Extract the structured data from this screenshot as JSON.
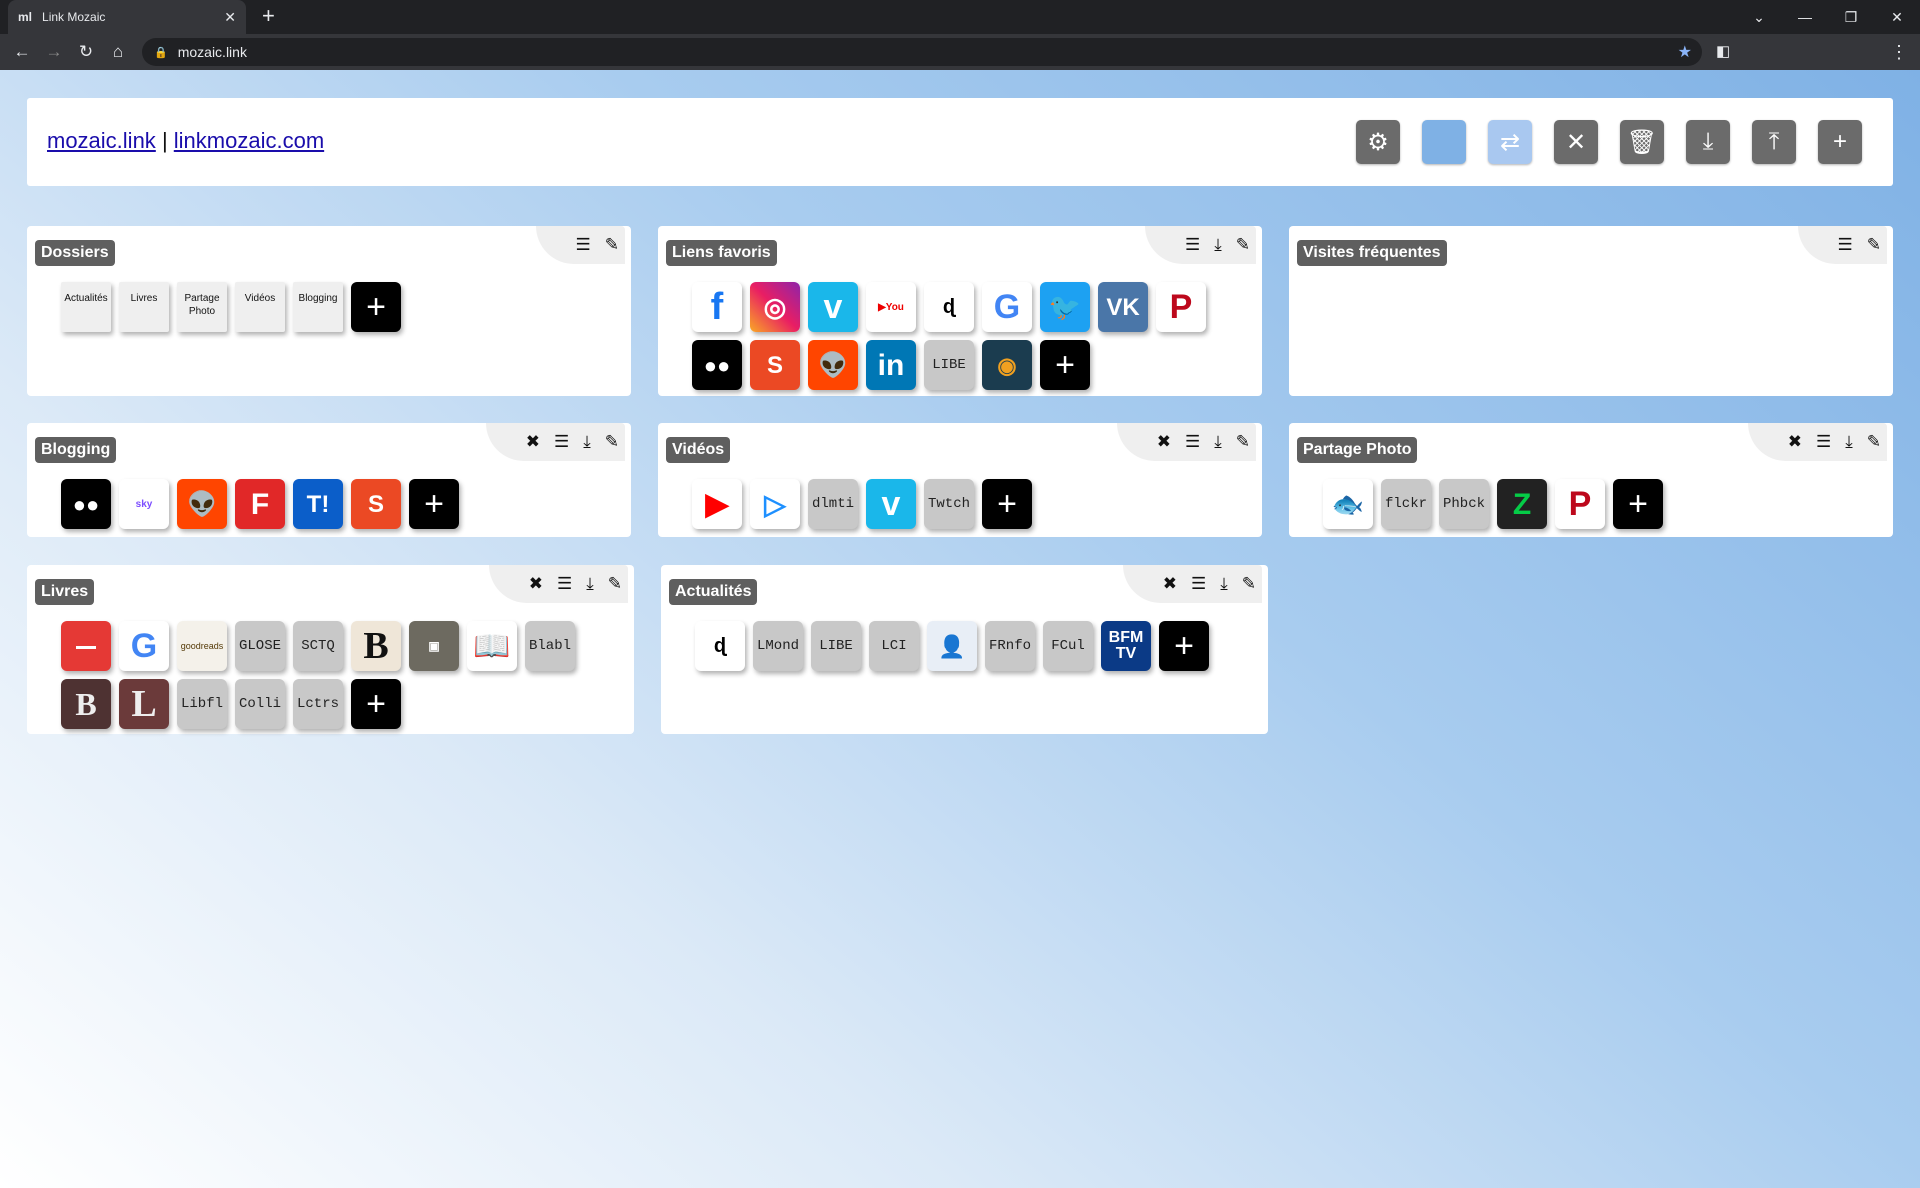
{
  "browser": {
    "tab_title": "Link Mozaic",
    "tab_favicon": "ml",
    "url": "mozaic.link"
  },
  "header": {
    "link1": "mozaic.link",
    "separator": "|",
    "link2": "linkmozaic.com"
  },
  "panels": {
    "dossiers": {
      "title": "Dossiers",
      "folders": [
        "Actualités",
        "Livres",
        "Partage Photo",
        "Vidéos",
        "Blogging"
      ]
    },
    "favoris": {
      "title": "Liens favoris",
      "row1": [
        "facebook",
        "instagram",
        "vimeo",
        "YouTube",
        "ld",
        "google",
        "twitter",
        "vk",
        "pinterest"
      ],
      "row2": [
        "medium",
        "stumbleupon",
        "reddit",
        "in",
        "LIBE",
        "slideshare"
      ]
    },
    "visites": {
      "title": "Visites fréquentes"
    },
    "blogging": {
      "title": "Blogging",
      "items": [
        "medium",
        "skyrock",
        "reddit",
        "flipboard",
        "T!",
        "stumbleupon"
      ]
    },
    "videos": {
      "title": "Vidéos",
      "items": [
        "youtube",
        "play",
        "dlmti",
        "vimeo",
        "Twtch"
      ]
    },
    "photo": {
      "title": "Partage Photo",
      "items": [
        "fish",
        "flckr",
        "Phbck",
        "deviantart",
        "pinterest"
      ]
    },
    "livres": {
      "title": "Livres",
      "row1": [
        "babelio",
        "google",
        "goodreads",
        "GLOSE",
        "SCTQ",
        "B",
        "h",
        "book",
        "Blabl"
      ],
      "row2": [
        "B",
        "L",
        "Libfl",
        "Colli",
        "Lctrs"
      ]
    },
    "actu": {
      "title": "Actualités",
      "items": [
        "ld",
        "LMond",
        "LIBE",
        "LCI",
        "fi",
        "FRnfo",
        "FCul",
        "BFM TV"
      ]
    }
  },
  "colors": {
    "accent": "#7fb1e5",
    "button_gray": "#6b6b6b"
  }
}
